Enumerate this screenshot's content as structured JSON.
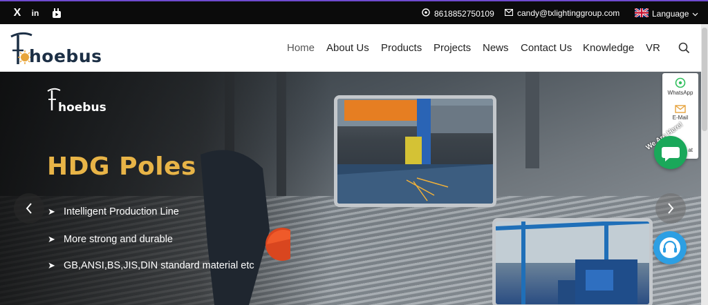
{
  "topbar": {
    "social": [
      "X",
      "in",
      "YouTube"
    ],
    "phone": "8618852750109",
    "email": "candy@txlightinggroup.com",
    "language_label": "Language"
  },
  "header": {
    "logo_text": "hoebus",
    "nav": [
      "Home",
      "About Us",
      "Products",
      "Projects",
      "News",
      "Contact Us",
      "Knowledge",
      "VR"
    ]
  },
  "hero": {
    "logo_text": "hoebus",
    "title": "HDG Poles",
    "bullets": [
      "Intelligent Production Line",
      "More strong and durable",
      "GB,ANSI,BS,JIS,DIN standard material etc"
    ],
    "prev": "‹",
    "next": "›"
  },
  "float": {
    "whatsapp_label": "WhatsApp",
    "email_label": "E-Mail",
    "chat_label": "at",
    "badge": "We Are Here!"
  },
  "colors": {
    "topbar_bg": "#0b0b0b",
    "title_gold": "#e8b447",
    "logo_navy": "#1c2f45",
    "logo_orange": "#e8a53a",
    "whatsapp_green": "#1aa85a",
    "support_blue": "#2d9fe3"
  }
}
